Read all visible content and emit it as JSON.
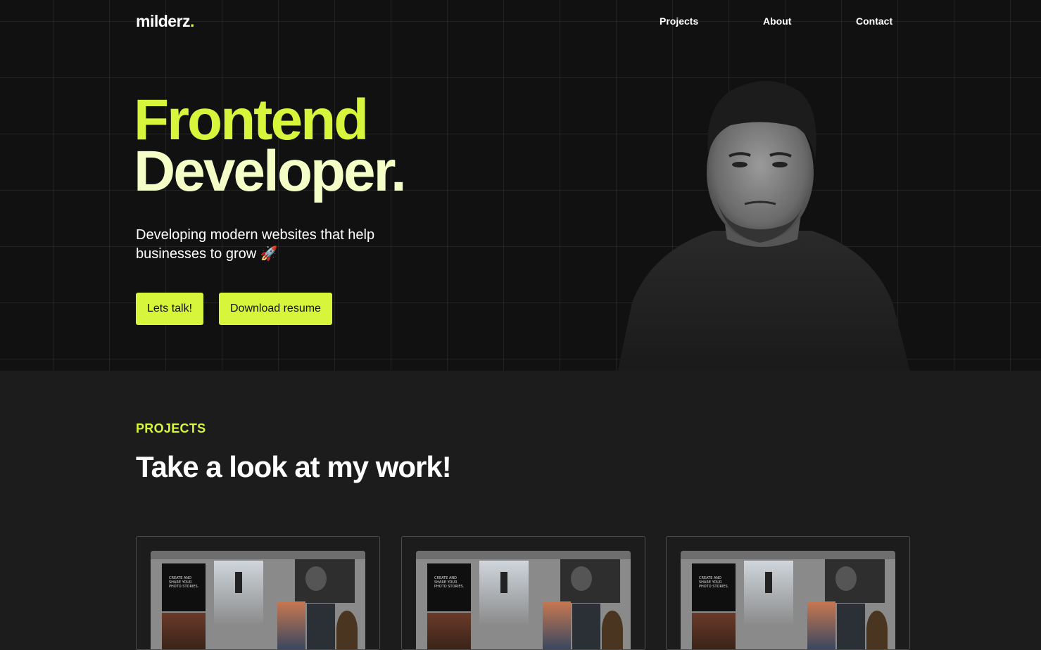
{
  "header": {
    "logo_text": "milderz",
    "logo_dot": ".",
    "nav": [
      {
        "label": "Projects"
      },
      {
        "label": "About"
      },
      {
        "label": "Contact"
      }
    ]
  },
  "hero": {
    "title_line1": "Frontend",
    "title_line2": "Developer.",
    "subtitle": "Developing modern websites that help businesses to grow 🚀",
    "buttons": {
      "talk_label": "Lets talk!",
      "resume_label": "Download resume"
    }
  },
  "projects": {
    "section_label": "PROJECTS",
    "section_title": "Take a look at my work!",
    "cards": [
      {
        "thumb_title": "CREATE AND SHARE YOUR PHOTO STORIES."
      },
      {
        "thumb_title": "CREATE AND SHARE YOUR PHOTO STORIES."
      },
      {
        "thumb_title": "CREATE AND SHARE YOUR PHOTO STORIES."
      }
    ]
  },
  "colors": {
    "accent": "#d7f53a",
    "hero_title_secondary": "#f3ffc7",
    "hero_background": "#111111",
    "section_background": "#1c1c1c"
  },
  "icons": {
    "subtitle_emoji": "rocket-icon"
  }
}
